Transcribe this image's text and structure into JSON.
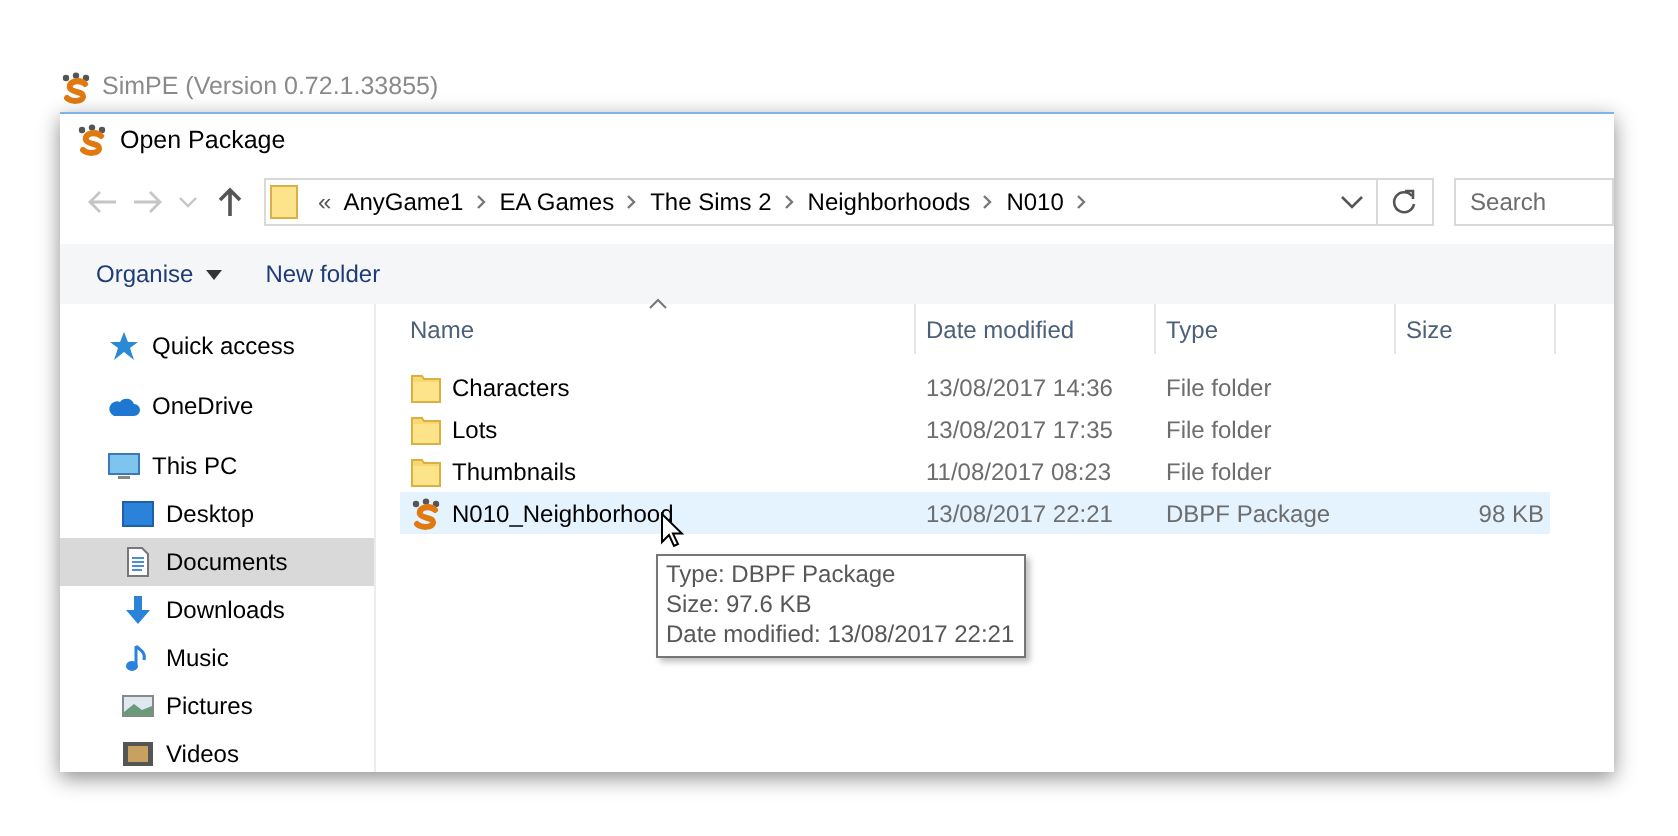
{
  "parent_window": {
    "title": "SimPE (Version 0.72.1.33855)"
  },
  "dialog": {
    "title": "Open Package"
  },
  "nav_buttons": [
    {
      "kind": "back",
      "disabled": true
    },
    {
      "kind": "forward",
      "disabled": true
    },
    {
      "kind": "recent",
      "disabled": true
    },
    {
      "kind": "up",
      "disabled": false
    }
  ],
  "address_bar": {
    "overflow": "«",
    "path": [
      "AnyGame1",
      "EA Games",
      "The Sims 2",
      "Neighborhoods",
      "N010"
    ]
  },
  "search": {
    "placeholder": "Search"
  },
  "toolbar": {
    "buttons": [
      {
        "label": "Organise",
        "dropdown": true
      },
      {
        "label": "New folder",
        "dropdown": false
      }
    ]
  },
  "sidebar": {
    "items": [
      {
        "kind": "quick-access",
        "label": "Quick access",
        "selected": false
      },
      {
        "kind": "onedrive",
        "label": "OneDrive",
        "selected": false
      },
      {
        "kind": "pc",
        "label": "This PC",
        "selected": false,
        "children": [
          {
            "kind": "desktop",
            "label": "Desktop",
            "selected": false
          },
          {
            "kind": "documents",
            "label": "Documents",
            "selected": true
          },
          {
            "kind": "downloads",
            "label": "Downloads",
            "selected": false
          },
          {
            "kind": "music",
            "label": "Music",
            "selected": false
          },
          {
            "kind": "pictures",
            "label": "Pictures",
            "selected": false
          },
          {
            "kind": "videos",
            "label": "Videos",
            "selected": false
          }
        ]
      }
    ]
  },
  "table": {
    "columns": [
      {
        "label": "Name",
        "sorted": true
      },
      {
        "label": "Date modified",
        "sorted": false
      },
      {
        "label": "Type",
        "sorted": false
      },
      {
        "label": "Size",
        "sorted": false
      }
    ],
    "rows": [
      {
        "kind": "folder",
        "name": "Characters",
        "date_modified": "13/08/2017 14:36",
        "type": "File folder",
        "hovered": false
      },
      {
        "kind": "folder",
        "name": "Lots",
        "date_modified": "13/08/2017 17:35",
        "type": "File folder",
        "hovered": false
      },
      {
        "kind": "folder",
        "name": "Thumbnails",
        "date_modified": "11/08/2017 08:23",
        "type": "File folder",
        "hovered": false
      },
      {
        "kind": "package",
        "name": "N010_Neighborhood",
        "date_modified": "13/08/2017 22:21",
        "type": "DBPF Package",
        "size": "98 KB",
        "hovered": true
      }
    ]
  },
  "tooltip": {
    "lines": [
      "Type: DBPF Package",
      "Size: 97.6 KB",
      "Date modified: 13/08/2017 22:21"
    ]
  }
}
